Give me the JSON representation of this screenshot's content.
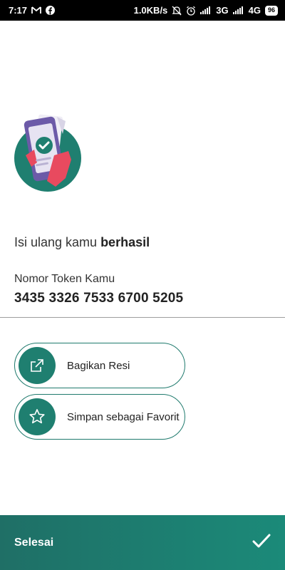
{
  "status_bar": {
    "time": "7:17",
    "left_icons": [
      "gmail-icon",
      "facebook-icon"
    ],
    "network_speed": "1.0KB/s",
    "network_3g": "3G",
    "network_4g": "4G",
    "battery": "96"
  },
  "result": {
    "message_prefix": "Isi ulang kamu ",
    "message_bold": "berhasil",
    "token_label": "Nomor Token Kamu",
    "token_number": "3435 3326 7533 6700 5205"
  },
  "actions": [
    {
      "label": "Bagikan Resi",
      "icon": "share-icon"
    },
    {
      "label": "Simpan sebagai Favorit",
      "icon": "star-icon"
    }
  ],
  "bottom_bar": {
    "label": "Selesai",
    "icon": "check-icon"
  },
  "colors": {
    "primary": "#1f7f70",
    "status_bar": "#000000"
  }
}
